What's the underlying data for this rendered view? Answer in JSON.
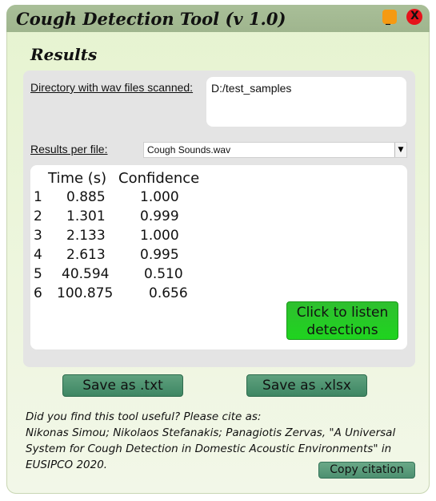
{
  "window": {
    "title": "Cough Detection Tool (v 1.0)",
    "minimize_glyph": "_",
    "close_glyph": "X"
  },
  "results": {
    "heading": "Results",
    "directory_label": "Directory with wav files scanned:",
    "directory_value": "D:/test_samples",
    "per_file_label": "Results per file:",
    "selected_file": "Cough Sounds.wav",
    "dropdown_glyph": "▼",
    "table": {
      "headers": [
        "Time (s)",
        "Confidence"
      ],
      "rows": [
        {
          "idx": "1",
          "time": "0.885",
          "conf": "1.000"
        },
        {
          "idx": "2",
          "time": "1.301",
          "conf": "0.999"
        },
        {
          "idx": "3",
          "time": "2.133",
          "conf": "1.000"
        },
        {
          "idx": "4",
          "time": "2.613",
          "conf": "0.995"
        },
        {
          "idx": "5",
          "time": "40.594",
          "conf": "0.510"
        },
        {
          "idx": "6",
          "time": "100.875",
          "conf": "0.656"
        }
      ]
    },
    "listen_line1": "Click to listen",
    "listen_line2": "detections"
  },
  "buttons": {
    "save_txt": "Save as .txt",
    "save_xlsx": "Save as .xlsx",
    "copy_citation": "Copy citation"
  },
  "citation": {
    "line1": "Did you find this tool useful? Please cite as:",
    "line2": "Nikonas Simou; Nikolaos Stefanakis; Panagiotis Zervas, \"A Universal",
    "line3": "System for Cough Detection in Domestic Acoustic Environments\" in",
    "line4": "EUSIPCO 2020."
  },
  "colors": {
    "title_bar": "#a9bf98",
    "window_bg": "#e6f3d0",
    "minimize": "#f59a12",
    "close": "#e5131b",
    "listen_button": "#2fbf2f",
    "save_button": "#4d9070"
  }
}
